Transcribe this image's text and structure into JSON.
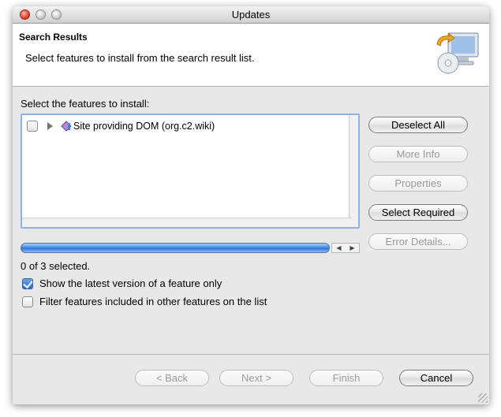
{
  "window": {
    "title": "Updates"
  },
  "header": {
    "title": "Search Results",
    "description": "Select features to install from the search result list.",
    "icon": "install-monitor-cd-icon"
  },
  "features": {
    "label": "Select the features to install:",
    "items": [
      {
        "label": "Site providing DOM (org.c2.wiki)",
        "checked": false,
        "icon": "update-site-icon"
      }
    ],
    "selected_count": "0 of 3 selected."
  },
  "side_buttons": {
    "deselect_all": "Deselect All",
    "more_info": "More Info",
    "properties": "Properties",
    "select_required": "Select Required",
    "error_details": "Error Details..."
  },
  "options": {
    "latest_version": {
      "label": "Show the latest version of a feature only",
      "checked": true
    },
    "filter_included": {
      "label": "Filter features included in other features on the list",
      "checked": false
    }
  },
  "nav": {
    "back": "< Back",
    "next": "Next >",
    "finish": "Finish",
    "cancel": "Cancel"
  },
  "colors": {
    "accent": "#3d86e3",
    "focus_border": "#8db2e3"
  }
}
